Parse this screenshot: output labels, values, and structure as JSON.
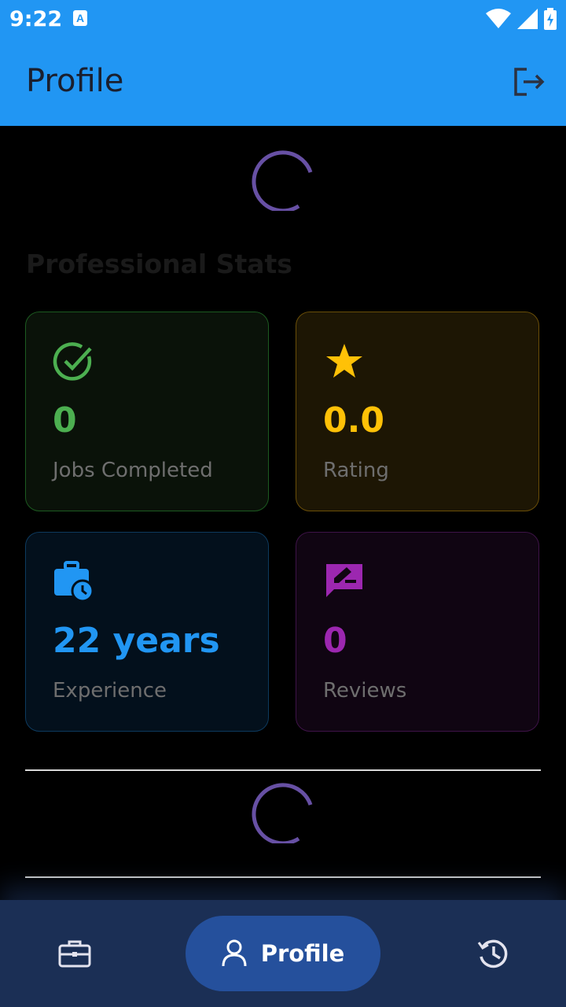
{
  "status_bar": {
    "time": "9:22",
    "notification_glyph": "A"
  },
  "app_bar": {
    "title": "Profile"
  },
  "stats": {
    "title": "Professional Stats",
    "cards": [
      {
        "value": "0",
        "label": "Jobs Completed",
        "color": "#4CAF50",
        "icon": "check-circle-icon"
      },
      {
        "value": "0.0",
        "label": "Rating",
        "color": "#FFC107",
        "icon": "star-icon"
      },
      {
        "value": "22 years",
        "label": "Experience",
        "color": "#2196F3",
        "icon": "work-history-icon"
      },
      {
        "value": "0",
        "label": "Reviews",
        "color": "#9C27B0",
        "icon": "rate-review-icon"
      }
    ]
  },
  "bottom_nav": {
    "items": [
      {
        "icon": "briefcase-icon"
      },
      {
        "label": "Profile",
        "icon": "person-icon",
        "selected": true
      },
      {
        "icon": "history-icon"
      }
    ]
  },
  "colors": {
    "primary": "#2196F3",
    "spinner": "#6750A4",
    "nav_bg": "#1b2f55",
    "nav_selected": "#25509c"
  }
}
